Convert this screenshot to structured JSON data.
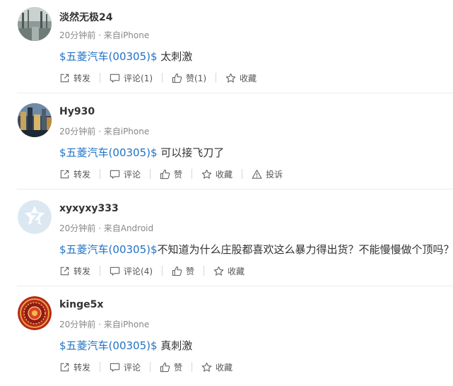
{
  "posts": [
    {
      "username": "淡然无极24",
      "time": "20分钟前",
      "source": "来自iPhone",
      "stock": "$五菱汽车(00305)$",
      "text": "太刺激",
      "actions": {
        "repost": "转发",
        "comment": "评论(1)",
        "like": "赞(1)",
        "favorite": "收藏"
      }
    },
    {
      "username": "Hy930",
      "time": "20分钟前",
      "source": "来自iPhone",
      "stock": "$五菱汽车(00305)$",
      "text": "可以接飞刀了",
      "actions": {
        "repost": "转发",
        "comment": "评论",
        "like": "赞",
        "favorite": "收藏",
        "report": "投诉"
      }
    },
    {
      "username": "xyxyxy333",
      "time": "20分钟前",
      "source": "来自Android",
      "stock": "$五菱汽车(00305)$",
      "text": "不知道为什么庄股都喜欢这么暴力得出货？不能慢慢做个顶吗？",
      "actions": {
        "repost": "转发",
        "comment": "评论(4)",
        "like": "赞",
        "favorite": "收藏"
      }
    },
    {
      "username": "kinge5x",
      "time": "20分钟前",
      "source": "来自iPhone",
      "stock": "$五菱汽车(00305)$",
      "text": "真刺激",
      "actions": {
        "repost": "转发",
        "comment": "评论",
        "like": "赞",
        "favorite": "收藏"
      }
    }
  ],
  "meta_separator": " · ",
  "colors": {
    "stock_link": "#1f72c4",
    "meta": "#888888",
    "divider": "#ececec"
  },
  "icons": {
    "repost": "share-box-icon",
    "comment": "comment-bubble-icon",
    "like": "thumbs-up-icon",
    "favorite": "star-icon",
    "report": "warning-triangle-icon"
  }
}
